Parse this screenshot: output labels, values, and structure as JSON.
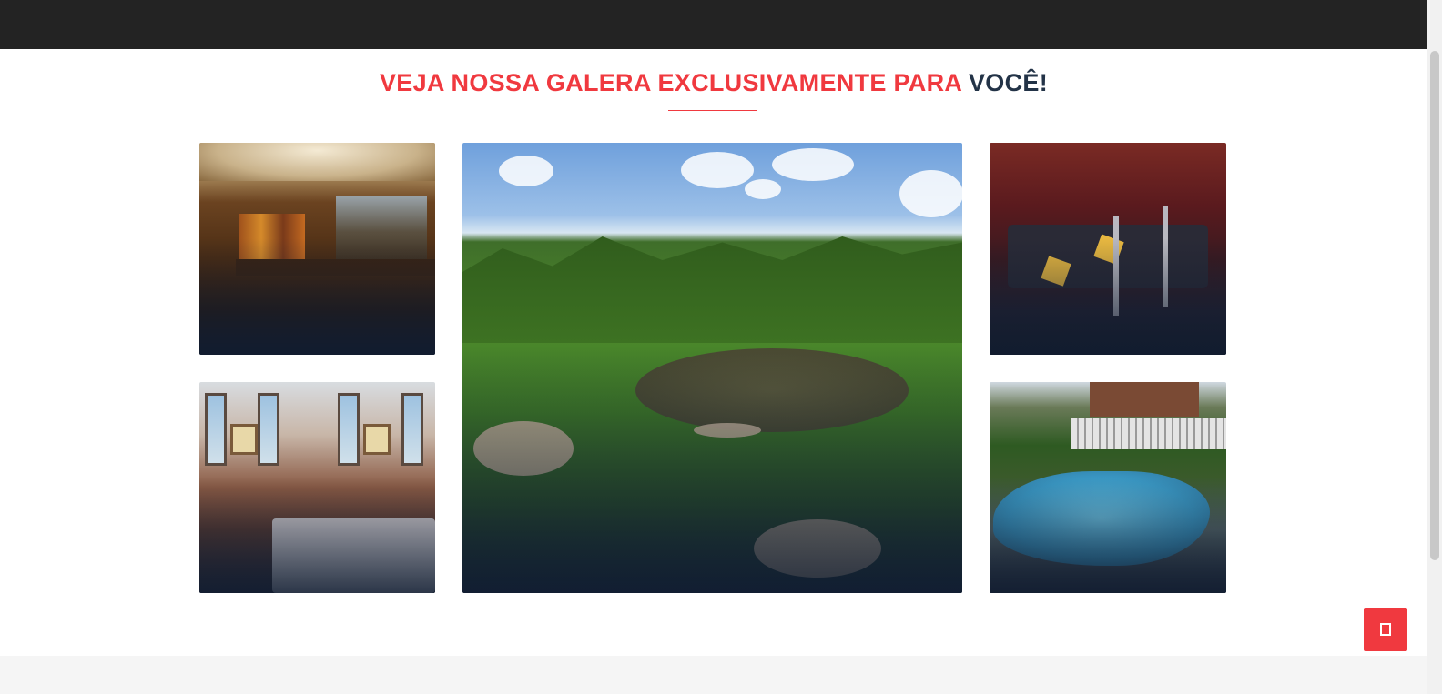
{
  "section": {
    "title_part1": "VEJA NOSSA GALERA EXCLUSIVAMENTE PARA",
    "title_part2": "VOCÊ!"
  },
  "gallery": {
    "items": [
      {
        "name": "bar-interior",
        "alt": ""
      },
      {
        "name": "golf-course",
        "alt": ""
      },
      {
        "name": "hookah-lounge",
        "alt": ""
      },
      {
        "name": "restaurant-dining",
        "alt": ""
      },
      {
        "name": "swimming-pool",
        "alt": ""
      }
    ]
  },
  "back_to_top": {
    "icon": "arrow-up-icon"
  },
  "colors": {
    "accent": "#f0393f",
    "dark_text": "#233347",
    "topbar": "#232323",
    "footer_band": "#f5f5f5"
  }
}
